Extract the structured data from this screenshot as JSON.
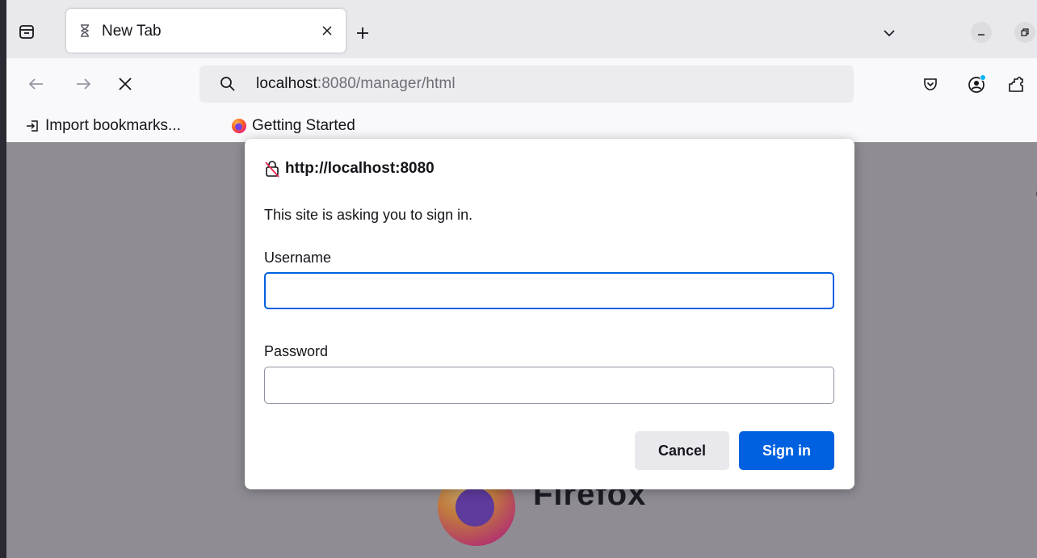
{
  "tabs": [
    {
      "title": "New Tab"
    }
  ],
  "urlbar": {
    "host": "localhost",
    "rest": ":8080/manager/html"
  },
  "bookmarks": [
    {
      "label": "Import bookmarks..."
    },
    {
      "label": "Getting Started"
    }
  ],
  "dialog": {
    "origin": "http://localhost:8080",
    "message": "This site is asking you to sign in.",
    "username_label": "Username",
    "username_value": "",
    "password_label": "Password",
    "password_value": "",
    "cancel_label": "Cancel",
    "signin_label": "Sign in"
  },
  "background": {
    "brand_word": "Firefox"
  },
  "colors": {
    "accent": "#0061e0",
    "content_overlay": "#8f8d93"
  },
  "icons": {
    "tab_list": "tab-list-icon",
    "tab_loading": "hourglass-icon",
    "close": "close-icon",
    "new_tab": "plus-icon",
    "back": "arrow-left-icon",
    "forward": "arrow-right-icon",
    "stop": "stop-icon",
    "search": "search-icon",
    "pocket": "pocket-icon",
    "account": "account-icon",
    "extensions": "extensions-icon",
    "import": "import-icon",
    "firefox": "firefox-logo-icon",
    "insecure_lock": "insecure-lock-icon"
  }
}
